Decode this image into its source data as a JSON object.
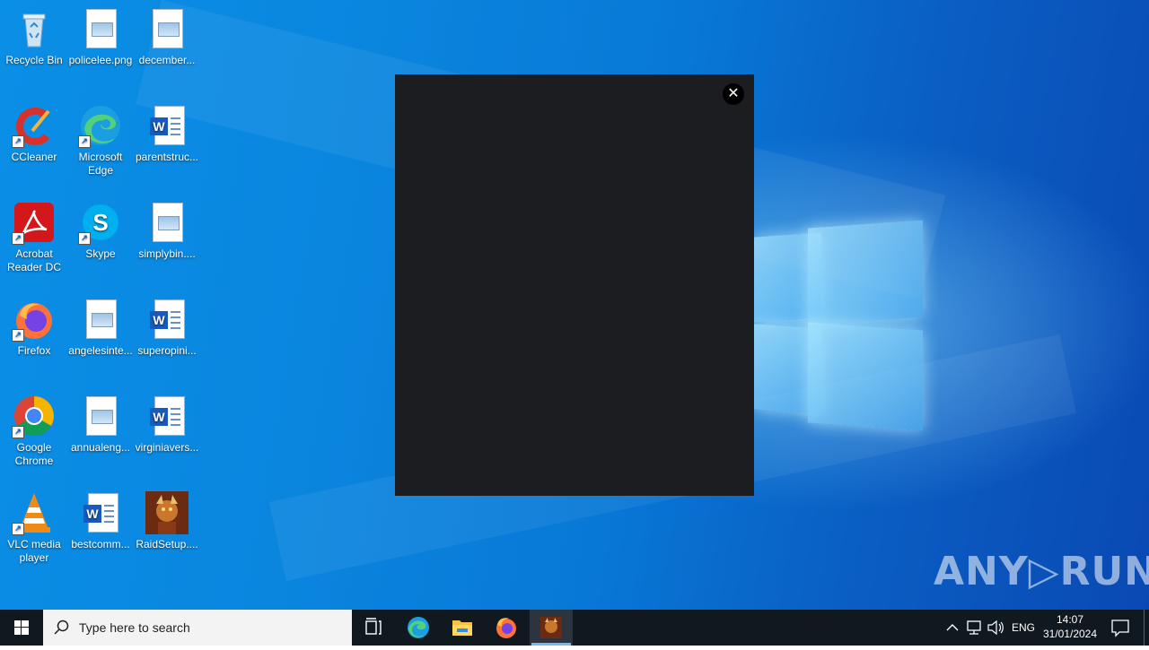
{
  "desktop": {
    "icons": [
      {
        "label": "Recycle Bin",
        "icon": "recycle-bin-icon"
      },
      {
        "label": "policelee.png",
        "icon": "image-file-icon"
      },
      {
        "label": "december...",
        "icon": "image-file-icon"
      },
      {
        "label": "CCleaner",
        "icon": "ccleaner-icon"
      },
      {
        "label": "Microsoft Edge",
        "icon": "edge-icon"
      },
      {
        "label": "parentstruc...",
        "icon": "word-document-icon"
      },
      {
        "label": "Acrobat Reader DC",
        "icon": "acrobat-icon"
      },
      {
        "label": "Skype",
        "icon": "skype-icon"
      },
      {
        "label": "simplybin....",
        "icon": "image-file-icon"
      },
      {
        "label": "Firefox",
        "icon": "firefox-icon"
      },
      {
        "label": "angelesinte...",
        "icon": "image-file-icon"
      },
      {
        "label": "superopini...",
        "icon": "word-document-icon"
      },
      {
        "label": "Google Chrome",
        "icon": "chrome-icon"
      },
      {
        "label": "annualeng...",
        "icon": "image-file-icon"
      },
      {
        "label": "virginiavers...",
        "icon": "word-document-icon"
      },
      {
        "label": "VLC media player",
        "icon": "vlc-icon"
      },
      {
        "label": "bestcomm...",
        "icon": "word-document-icon"
      },
      {
        "label": "RaidSetup....",
        "icon": "raid-setup-icon"
      }
    ]
  },
  "popup": {
    "close_glyph": "✕"
  },
  "watermark": "ANY▷RUN",
  "taskbar": {
    "search_placeholder": "Type here to search",
    "lang": "ENG",
    "time": "14:07",
    "date": "31/01/2024"
  },
  "colors": {
    "popup_bg": "#1b1d20",
    "taskbar_bg": "#101820",
    "desktop_accent": "#0a86df"
  }
}
